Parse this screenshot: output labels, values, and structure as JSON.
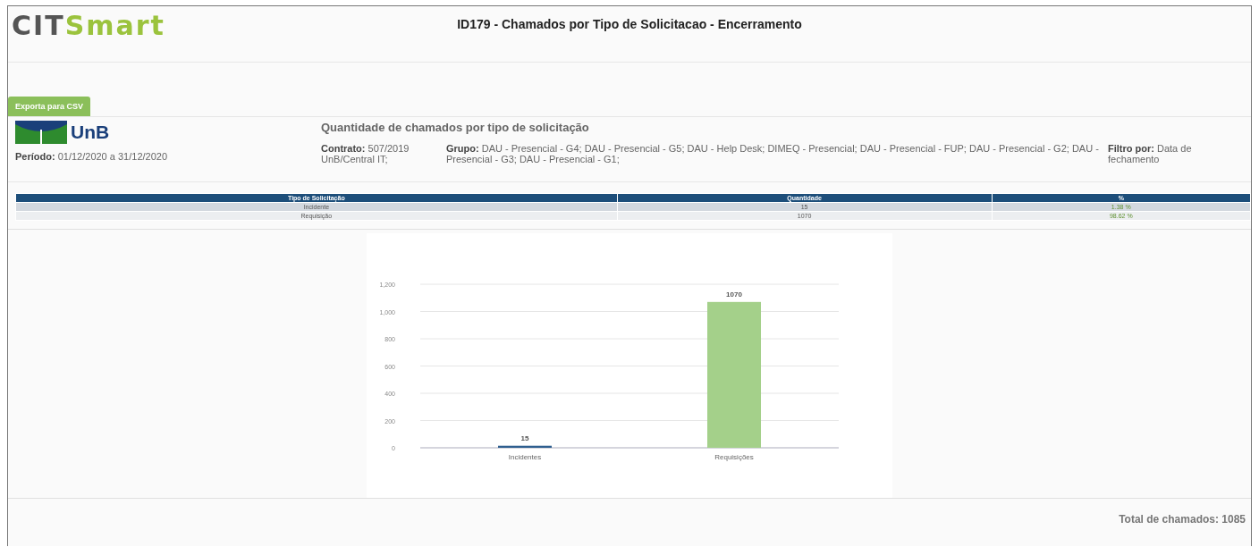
{
  "header": {
    "logo": {
      "part1": "CIT",
      "part2": "Smart"
    },
    "title": "ID179 - Chamados por Tipo de Solicitacao - Encerramento"
  },
  "export_button": "Exporta para CSV",
  "info": {
    "org_logo": "UnB",
    "period_label": "Período:",
    "period": "01/12/2020 a 31/12/2020",
    "heading": "Quantidade de chamados por tipo de solicitação",
    "fields": [
      {
        "label": "Contrato:",
        "value": "507/2019 UnB/Central IT;"
      },
      {
        "label": "Grupo:",
        "value": "DAU - Presencial - G4; DAU - Presencial - G5; DAU - Help Desk; DIMEQ - Presencial; DAU - Presencial - FUP; DAU - Presencial - G2; DAU - Presencial - G3; DAU - Presencial - G1;"
      },
      {
        "label": "Filtro por:",
        "value": "Data de fechamento"
      }
    ]
  },
  "table": {
    "columns": [
      "Tipo de Solicitação",
      "Quantidade",
      "%"
    ],
    "rows": [
      [
        "Incidente",
        "15",
        "1.38 %"
      ],
      [
        "Requisição",
        "1070",
        "98.62 %"
      ]
    ]
  },
  "chart_data": {
    "type": "bar",
    "categories": [
      "Incidentes",
      "Requisições"
    ],
    "series": [
      {
        "color": "#2f5f8f",
        "values": [
          15,
          null
        ]
      },
      {
        "color": "#a4d08a",
        "values": [
          null,
          1070
        ]
      }
    ],
    "grid": true,
    "ylim": [
      0,
      1200
    ],
    "yticks": [
      {
        "value": 0,
        "label": "0"
      },
      {
        "value": 200,
        "label": "200"
      },
      {
        "value": 400,
        "label": "400"
      },
      {
        "value": 600,
        "label": "600"
      },
      {
        "value": 800,
        "label": "800"
      },
      {
        "value": 1000,
        "label": "1,000"
      },
      {
        "value": 1200,
        "label": "1,200"
      }
    ],
    "data_labels": true
  },
  "total": "Total de chamados: 1085"
}
